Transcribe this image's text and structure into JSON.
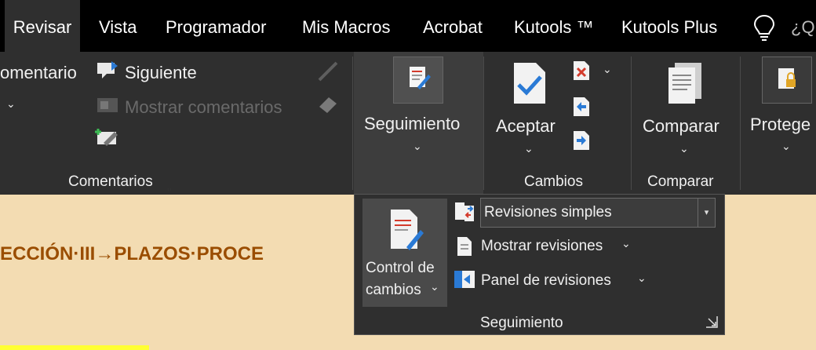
{
  "tabs": [
    {
      "label": "Revisar",
      "active": true
    },
    {
      "label": "Vista"
    },
    {
      "label": "Programador"
    },
    {
      "label": "Mis Macros"
    },
    {
      "label": "Acrobat"
    },
    {
      "label": "Kutools ™"
    },
    {
      "label": "Kutools Plus"
    }
  ],
  "tell_me": "¿Q",
  "comments_group": {
    "new_comment_partial": "omentario",
    "next": "Siguiente",
    "show_comments": "Mostrar comentarios",
    "group_label": "Comentarios"
  },
  "tracking_group": {
    "button_label": "Seguimiento",
    "group_label": "Seguimiento"
  },
  "changes_group": {
    "accept_label": "Aceptar",
    "group_label": "Cambios"
  },
  "compare_group": {
    "compare_label": "Comparar",
    "group_label": "Comparar"
  },
  "protect_group": {
    "protect_label": "Protege"
  },
  "dropdown": {
    "track_changes_line1": "Control de",
    "track_changes_line2": "cambios",
    "markup_select_value": "Revisiones simples",
    "show_markup": "Mostrar revisiones",
    "reviewing_pane": "Panel de revisiones",
    "footer_label": "Seguimiento"
  },
  "document": {
    "heading": "ECCIÓN·III→PLAZOS·PROCE",
    "quote_mark": "\""
  },
  "colors": {
    "tab_bar": "#000000",
    "ribbon": "#2f2f2f",
    "document_bg": "#f3dcb2",
    "heading": "#9a4d00",
    "icon_blue": "#2a7ad5",
    "icon_red": "#d33b2c"
  }
}
